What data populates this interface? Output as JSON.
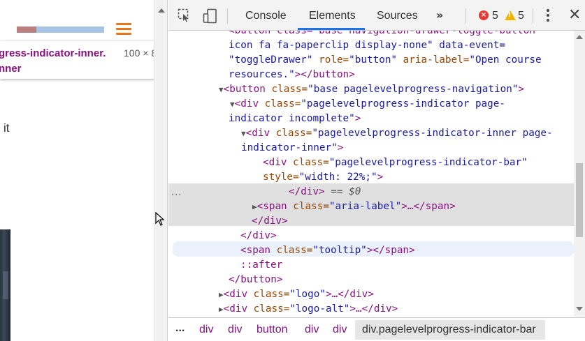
{
  "page": {
    "progress": {
      "fill_percent": 22,
      "track_color": "#a7c4e5",
      "fill_color": "#b9807f"
    },
    "menu_icon_color": "#e8741b",
    "tooltip": {
      "line1": "gress-indicator-inner.",
      "size": "100 × 8",
      "line2": "nner"
    },
    "text_fragment": "it"
  },
  "devtools": {
    "tabs": [
      "Console",
      "Elements",
      "Sources"
    ],
    "active_tab": "Elements",
    "more_tabs": "»",
    "errors": "5",
    "warnings": "5",
    "dom": {
      "l0": "<button class=\"base navigation-drawer-toggle-button",
      "l1": "icon fa fa-paperclip display-none\" data-event=",
      "l2a": "\"toggleDrawer\"",
      "l2b": " role=",
      "l2c": "\"button\"",
      "l2d": " aria-label=",
      "l2e": "\"Open course",
      "l3a": "resources.\"",
      "l3b": "></button>",
      "l4a": "<button",
      "l4b": " class=",
      "l4c": "\"base pagelevelprogress-navigation\"",
      "l4d": ">",
      "l5a": "<div",
      "l5b": " class=",
      "l5c": "\"pagelevelprogress-indicator page-",
      "l6a": "indicator incomplete\"",
      "l6b": ">",
      "l7a": "<div",
      "l7b": " class=",
      "l7c": "\"pagelevelprogress-indicator-inner page-",
      "l8a": "indicator-inner\"",
      "l8b": ">",
      "l9a": "<div",
      "l9b": " class=",
      "l9c": "\"pagelevelprogress-indicator-bar\"",
      "l10a": "style=",
      "l10b": "\"width: 22%;\"",
      "l10c": ">",
      "l11a": "</div>",
      "l11b": " == $0",
      "l12a": "<span",
      "l12b": " class=",
      "l12c": "\"aria-label\"",
      "l12d": ">…</span>",
      "l13": "</div>",
      "l14": "</div>",
      "l15a": "<span",
      "l15b": " class=",
      "l15c": "\"tooltip\"",
      "l15d": "></span>",
      "l16": "::after",
      "l17": "</button>",
      "l18a": "<div",
      "l18b": " class=",
      "l18c": "\"logo\"",
      "l18d": ">…</div>",
      "l19a": "<div",
      "l19b": " class=",
      "l19c": "\"logo-alt\"",
      "l19d": ">…</div>",
      "ellipsis": "..."
    },
    "breadcrumbs": [
      "...",
      "div",
      "div",
      "button",
      "div",
      "div",
      "div.pagelevelprogress-indicator-bar"
    ]
  }
}
